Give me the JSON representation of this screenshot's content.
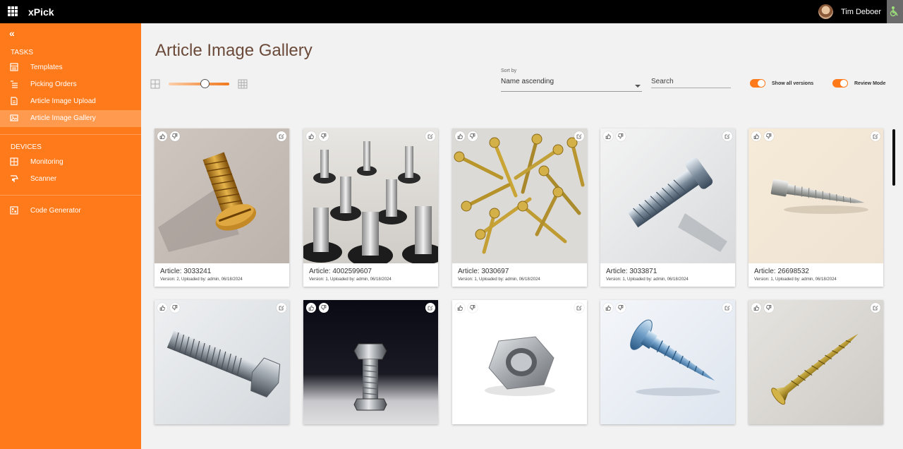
{
  "app": {
    "title": "xPick",
    "user_name": "Tim Deboer"
  },
  "sidebar": {
    "sections": [
      {
        "title": "TASKS",
        "items": [
          {
            "label": "Templates",
            "icon": "templates-icon"
          },
          {
            "label": "Picking Orders",
            "icon": "list-icon"
          },
          {
            "label": "Article Image Upload",
            "icon": "upload-doc-icon"
          },
          {
            "label": "Article Image Gallery",
            "icon": "image-icon",
            "active": true
          }
        ]
      },
      {
        "title": "DEVICES",
        "items": [
          {
            "label": "Monitoring",
            "icon": "grid-icon"
          },
          {
            "label": "Scanner",
            "icon": "scanner-icon"
          }
        ]
      },
      {
        "title": "",
        "items": [
          {
            "label": "Code Generator",
            "icon": "qr-code-icon"
          }
        ]
      }
    ]
  },
  "page": {
    "title": "Article Image Gallery"
  },
  "toolbar": {
    "zoom_slider_value": 0.6,
    "sort_label": "Sort by",
    "sort_value": "Name ascending",
    "search_placeholder": "Search",
    "show_all_versions": {
      "label": "Show all versions",
      "on": true
    },
    "review_mode": {
      "label": "Review Mode",
      "on": true
    }
  },
  "colors": {
    "accent": "#ff7a1a",
    "topbar": "#000000",
    "background": "#f2f2f2"
  },
  "gallery": {
    "cards": [
      {
        "title": "Article: 3033241",
        "meta": "Version: 2, Uploaded by: admin, 06/18/2024",
        "image": "brass-slotted-screw"
      },
      {
        "title": "Article: 4002599607",
        "meta": "Version: 1, Uploaded by: admin, 06/18/2024",
        "image": "roofing-screws"
      },
      {
        "title": "Article: 3030697",
        "meta": "Version: 1, Uploaded by: admin, 06/18/2024",
        "image": "pile-of-wood-screws"
      },
      {
        "title": "Article: 3033871",
        "meta": "Version: 1, Uploaded by: admin, 06/18/2024",
        "image": "steel-bolt"
      },
      {
        "title": "Article: 26698532",
        "meta": "Version: 1, Uploaded by: admin, 06/18/2024",
        "image": "hex-lag-screw"
      },
      {
        "title": "",
        "meta": "",
        "image": "hex-bolt"
      },
      {
        "title": "",
        "meta": "",
        "image": "hex-bolt-dark"
      },
      {
        "title": "",
        "meta": "",
        "image": "hex-nut"
      },
      {
        "title": "",
        "meta": "",
        "image": "flange-self-tapping-screw"
      },
      {
        "title": "",
        "meta": "",
        "image": "countersunk-wood-screw"
      }
    ]
  }
}
